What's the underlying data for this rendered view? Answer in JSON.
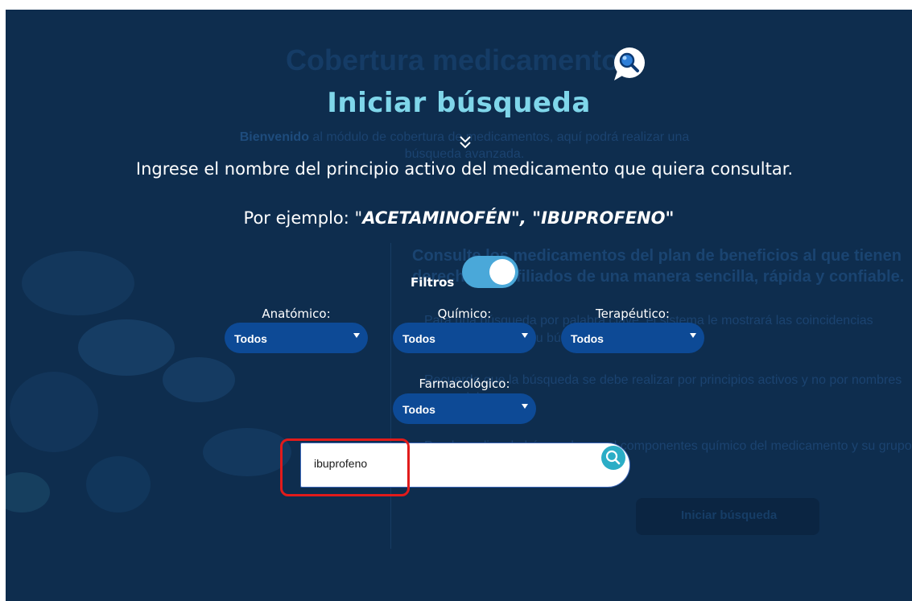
{
  "background": {
    "title": "Cobertura medicamentos",
    "intro_bold": "Bienvenido",
    "intro_rest": " al módulo de cobertura de medicamentos, aquí podrá realizar una búsqueda avanzada.",
    "heading": "Consulte los medicamentos del plan de beneficios al que tienen derecho los afiliados de una manera sencilla, rápida y confiable.",
    "bullet1": "Para una búsqueda por palabra clave, el sistema le mostrará las coincidencias posibles para que su búsqueda sea más fácil.",
    "bullet2": "Recuerde que la búsqueda se debe realizar por principios activos y no por nombres comerciales.",
    "bullet3": "Puede realizar la búsqueda por el componentes químico del medicamento y su grupo anatómico.",
    "button_label": "Iniciar búsqueda"
  },
  "modal": {
    "title": "Iniciar búsqueda",
    "instruction": "Ingrese el nombre del principio activo del medicamento que quiera consultar.",
    "example_prefix": "Por ejemplo: \"",
    "example_items": "ACETAMINOFÉN\", \"IBUPROFENO",
    "example_suffix": "\""
  },
  "filters": {
    "label": "Filtros",
    "enabled": true,
    "anatomico": {
      "label": "Anatómico:",
      "value": "Todos"
    },
    "quimico": {
      "label": "Químico:",
      "value": "Todos"
    },
    "terapeutico": {
      "label": "Terapéutico:",
      "value": "Todos"
    },
    "farmacologico": {
      "label": "Farmacológico:",
      "value": "Todos"
    }
  },
  "search": {
    "value": "ibuprofeno"
  },
  "colors": {
    "overlay": "#0e2d4e",
    "title": "#7fd6ea",
    "select": "#0d4a96",
    "toggle": "#4aa8d9",
    "search_button": "#2badc6",
    "highlight": "#e11b1b"
  },
  "icons": [
    "search-bubble-icon",
    "chevron-double-down-icon",
    "dropdown-arrow-icon",
    "search-icon"
  ]
}
